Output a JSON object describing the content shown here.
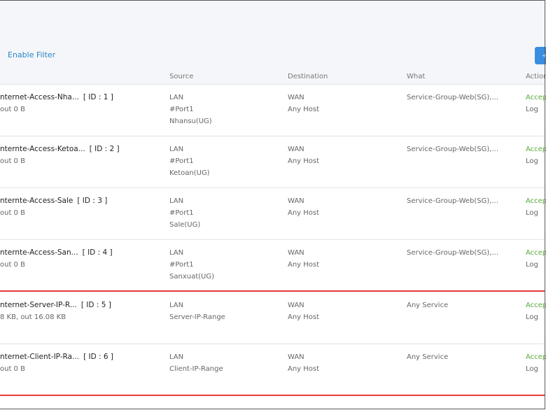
{
  "filter": {
    "enable_label": "Enable Filter"
  },
  "top_button": {
    "label": "+"
  },
  "columns": {
    "source": "Source",
    "destination": "Destination",
    "what": "What",
    "action": "Action"
  },
  "rules": [
    {
      "name": "nternet-Access-Nha...",
      "id": "[ ID : 1 ]",
      "traffic": "out 0 B",
      "source": [
        "LAN",
        "#Port1",
        "Nhansu(UG)"
      ],
      "destination": [
        "WAN",
        "Any Host"
      ],
      "what": "Service-Group-Web(SG),...",
      "action": "Accept",
      "log": "Log",
      "alert": false
    },
    {
      "name": "nternte-Access-Ketoa...",
      "id": "[ ID : 2 ]",
      "traffic": "out 0 B",
      "source": [
        "LAN",
        "#Port1",
        "Ketoan(UG)"
      ],
      "destination": [
        "WAN",
        "Any Host"
      ],
      "what": "Service-Group-Web(SG),...",
      "action": "Accept",
      "log": "Log",
      "alert": false
    },
    {
      "name": "nternte-Access-Sale",
      "id": "[ ID : 3 ]",
      "traffic": "out 0 B",
      "source": [
        "LAN",
        "#Port1",
        "Sale(UG)"
      ],
      "destination": [
        "WAN",
        "Any Host"
      ],
      "what": "Service-Group-Web(SG),...",
      "action": "Accept",
      "log": "Log",
      "alert": false
    },
    {
      "name": "nternte-Access-San...",
      "id": "[ ID : 4 ]",
      "traffic": "out 0 B",
      "source": [
        "LAN",
        "#Port1",
        "Sanxuat(UG)"
      ],
      "destination": [
        "WAN",
        "Any Host"
      ],
      "what": "Service-Group-Web(SG),...",
      "action": "Accept",
      "log": "Log",
      "alert": true
    },
    {
      "name": "nternet-Server-IP-R...",
      "id": "[ ID : 5 ]",
      "traffic": "8 KB, out 16.08 KB",
      "source": [
        "LAN",
        "Server-IP-Range"
      ],
      "destination": [
        "WAN",
        "Any Host"
      ],
      "what": "Any Service",
      "action": "Accept",
      "log": "Log",
      "alert": false
    },
    {
      "name": "nternet-Client-IP-Ra...",
      "id": "[ ID : 6 ]",
      "traffic": "out 0 B",
      "source": [
        "LAN",
        "Client-IP-Range"
      ],
      "destination": [
        "WAN",
        "Any Host"
      ],
      "what": "Any Service",
      "action": "Accept",
      "log": "Log",
      "alert": true
    }
  ]
}
